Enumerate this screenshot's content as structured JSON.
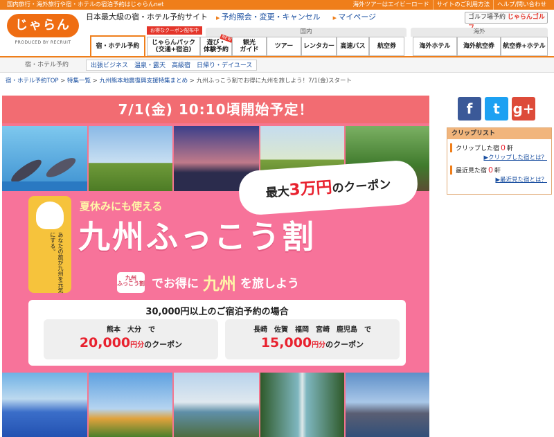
{
  "topbar": {
    "left": "国内旅行・海外旅行や宿・ホテルの宿泊予約はじゃらんnet",
    "right": [
      "海外ツアーはエイビーロード",
      "サイトのご利用方法",
      "ヘルプ/問い合わせ"
    ]
  },
  "logo": {
    "mark": "じゃらん",
    "sub": "PRODUCED BY RECRUIT"
  },
  "tagline": "日本最大級の宿・ホテル予約サイト",
  "toplinks": [
    "予約照会・変更・キャンセル",
    "マイページ"
  ],
  "golf": {
    "label": "ゴルフ場予約",
    "brand": "じゃらんゴルフ"
  },
  "nav": {
    "domestic_label": "国内",
    "overseas_label": "海外",
    "coupon_flag": "お得なクーポン配布中",
    "new_badge": "NEW",
    "tabs": [
      {
        "label": "宿・ホテル予約",
        "active": true
      },
      {
        "label": "じゃらんパック\n(交通+宿泊)"
      },
      {
        "label": "遊び・\n体験予約"
      },
      {
        "label": "観光\nガイド"
      },
      {
        "label": "ツアー"
      },
      {
        "label": "レンタカー"
      },
      {
        "label": "高速バス"
      },
      {
        "label": "航空券"
      },
      {
        "label": "海外ホテル"
      },
      {
        "label": "海外航空券"
      },
      {
        "label": "航空券+ホテル"
      }
    ]
  },
  "subnav": {
    "label": "宿・ホテル予約",
    "links": [
      "出張ビジネス",
      "温泉・露天",
      "高級宿",
      "日帰り・デイユース"
    ]
  },
  "breadcrumb": [
    "宿・ホテル予約TOP",
    "特集一覧",
    "九州熊本地震復興支援特集まとめ",
    "九州ふっこう割でお得に九州を旅しよう！7/1(金)スタート"
  ],
  "banner": {
    "date": "7/1(金) 10:10頃開始予定！",
    "bubble_pre": "最大",
    "bubble_amount": "3万円",
    "bubble_post": "のクーポン",
    "mascot_text": "あなたの旅が九州を元気にする。",
    "summer": "夏休みにも使える",
    "title": "九州ふっこう割",
    "suitcase": "九州\nふっこう割",
    "tag_pre": "でお得に",
    "tag_kyushu": "九州",
    "tag_post": "を旅しよう",
    "coupon_head": "30,000円以上のご宿泊予約の場合",
    "coupons": [
      {
        "prefs": "熊本　大分　で",
        "amount": "20,000",
        "unit": "円分",
        "suffix": "のクーポン"
      },
      {
        "prefs": "長崎　佐賀　福岡　宮崎　鹿児島　で",
        "amount": "15,000",
        "unit": "円分",
        "suffix": "のクーポン"
      }
    ]
  },
  "share": [
    {
      "icon": "facebook-icon",
      "glyph": "f",
      "color": "#3b5998"
    },
    {
      "icon": "twitter-icon",
      "glyph": "t",
      "color": "#1da1f2"
    },
    {
      "icon": "googleplus-icon",
      "glyph": "g+",
      "color": "#dd4b39"
    }
  ],
  "clip": {
    "title": "クリップリスト",
    "clipped_label": "クリップした宿",
    "clipped_count": "0",
    "clipped_unit": "軒",
    "clipped_link": "クリップした宿とは？",
    "recent_label": "最近見た宿",
    "recent_count": "0",
    "recent_unit": "軒",
    "recent_link": "最近見た宿とは？"
  }
}
